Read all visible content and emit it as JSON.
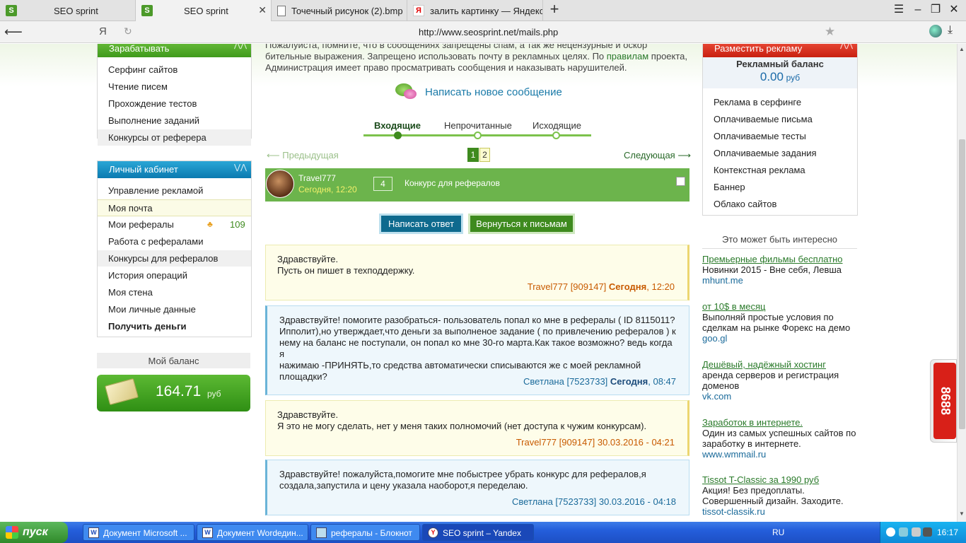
{
  "browser": {
    "tabs": [
      {
        "title": "SEO sprint",
        "icon": "seosprint-icon",
        "active": false
      },
      {
        "title": "SEO sprint",
        "icon": "seosprint-icon",
        "active": true
      },
      {
        "title": "Точечный рисунок (2).bmp",
        "icon": "document-icon",
        "active": false
      },
      {
        "title": "залить картинку — Яндекс:",
        "icon": "yandex-icon",
        "active": false
      }
    ],
    "yandex_logo": "Я",
    "url": "http://www.seosprint.net/mails.php"
  },
  "left_sidebar": {
    "earn": {
      "title": "Зарабатывать",
      "items": [
        "Серфинг сайтов",
        "Чтение писем",
        "Прохождение тестов",
        "Выполнение заданий",
        "Конкурсы от реферера"
      ]
    },
    "cabinet": {
      "title": "Личный кабинет",
      "items": [
        "Управление рекламой",
        "Моя почта",
        "Мои рефералы",
        "Работа с рефералами",
        "Конкурсы для рефералов",
        "История операций",
        "Моя стена",
        "Мои личные данные",
        "Получить деньги"
      ],
      "referrals_count": "109"
    },
    "balance": {
      "label": "Мой баланс",
      "value": "164.71",
      "currency": "руб"
    }
  },
  "main": {
    "intro_line1": "Пожалуйста, помните, что в сообщениях запрещены спам, а так же нецензурные и оскор",
    "intro_line2_a": "бительные выражения. Запрещено использовать почту в рекламных целях. По ",
    "intro_link": "правилам",
    "intro_line2_b": " проекта,",
    "intro_line3": "Администрация имеет право просматривать сообщения и наказывать нарушителей.",
    "compose_label": "Написать новое сообщение",
    "mail_tabs": [
      "Входящие",
      "Непрочитанные",
      "Исходящие"
    ],
    "pagination": {
      "prev": "⟵ Предыдущая",
      "next": "Следующая ⟶",
      "pages": [
        "1",
        "2"
      ],
      "current": "1"
    },
    "mail_row": {
      "sender": "Travel777",
      "time": "Сегодня, 12:20",
      "count": "4",
      "subject": "Конкурс для рефералов"
    },
    "reply_button": "Написать ответ",
    "return_button": "Вернуться к письмам",
    "messages": [
      {
        "style": "yellow",
        "lines": [
          "Здравствуйте.",
          "Пусть он пишет в техподдержку."
        ],
        "sign_name": "Travel777 [909147] ",
        "sign_bold": "Сегодня",
        "sign_tail": ", 12:20"
      },
      {
        "style": "blue",
        "lines": [
          "Здравствуйте! помогите разобраться- пользователь попал ко мне в рефералы ( ID 8115011?",
          "Ипполит),но утверждает,что деньги за выполненое задание ( по привлечению рефералов ) к",
          "нему на баланс не поступали, он попал ко мне 30-го марта.Как такое возможно? ведь когда я",
          "нажимаю -ПРИНЯТЬ,то средства автоматически списываются же с моей рекламной",
          "площадки?"
        ],
        "sign_name": "Светлана [7523733] ",
        "sign_bold": "Сегодня",
        "sign_tail": ", 08:47"
      },
      {
        "style": "yellow",
        "lines": [
          "Здравствуйте.",
          "Я это не могу сделать, нет у меня таких полномочий (нет доступа к чужим конкурсам)."
        ],
        "sign_name": "Travel777 [909147] 30.03.2016 - 04:21",
        "sign_bold": "",
        "sign_tail": ""
      },
      {
        "style": "blue",
        "lines": [
          "Здравствуйте! пожалуйста,помогите мне побыстрее убрать конкурс для рефералов,я",
          "создала,запустила и цену указала наоборот,я переделаю."
        ],
        "sign_name": "Светлана [7523733] 30.03.2016 - 04:18",
        "sign_bold": "",
        "sign_tail": ""
      }
    ]
  },
  "right_sidebar": {
    "advertise": {
      "title": "Разместить рекламу",
      "balance_title": "Рекламный баланс",
      "balance_value": "0.00",
      "balance_currency": "руб",
      "items": [
        "Реклама в серфинге",
        "Оплачиваемые письма",
        "Оплачиваемые тесты",
        "Оплачиваемые задания",
        "Контекстная реклама",
        "Баннер",
        "Облако сайтов"
      ]
    },
    "interest_title": "Это может быть интересно",
    "ads": [
      {
        "title": "Премьерные фильмы бесплатно",
        "text": [
          "Новинки 2015 - Вне себя, Левша"
        ],
        "url": "mhunt.me"
      },
      {
        "title": "от 10$ в месяц",
        "text": [
          "Выполняй простые условия по",
          "сделкам на рынке Форекс на демо"
        ],
        "url": "goo.gl"
      },
      {
        "title": "Дешёвый, надёжный хостинг",
        "text": [
          "аренда серверов и регистрация",
          "доменов"
        ],
        "url": "vk.com"
      },
      {
        "title": "Заработок в интернете.",
        "text": [
          "Один из самых успешных сайтов по",
          "заработку в интернете."
        ],
        "url": "www.wmmail.ru"
      },
      {
        "title": "Tissot T-Classic за 1990 руб",
        "text": [
          "Акция! Без предоплаты.",
          "Совершенный дизайн. Заходите."
        ],
        "url": "tissot-classik.ru"
      }
    ],
    "side_widget_text": "8688"
  },
  "taskbar": {
    "start_label": "пуск",
    "tasks": [
      {
        "label": "Документ Microsoft ...",
        "icon": "word-icon"
      },
      {
        "label": "Документ Wordедин...",
        "icon": "word-icon"
      },
      {
        "label": "рефералы - Блокнот",
        "icon": "notepad-icon"
      },
      {
        "label": "SEO sprint – Yandex",
        "icon": "yandex-icon"
      }
    ],
    "lang": "RU",
    "clock": "16:17"
  }
}
